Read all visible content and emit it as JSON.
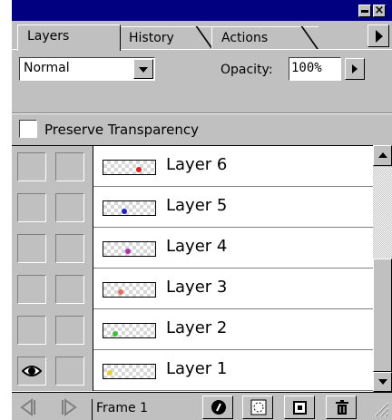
{
  "tabs": [
    {
      "label": "Layers",
      "active": true
    },
    {
      "label": "History",
      "active": false
    },
    {
      "label": "Actions",
      "active": false
    }
  ],
  "blend": {
    "mode": "Normal",
    "opacity_label": "Opacity:",
    "opacity_value": "100%"
  },
  "preserve": {
    "label": "Preserve Transparency",
    "checked": false
  },
  "layers": [
    {
      "name": "Layer 6",
      "visible": false,
      "thumb_icon": "red-mark",
      "thumb_color": "#e02020"
    },
    {
      "name": "Layer 5",
      "visible": false,
      "thumb_icon": "blue-mark",
      "thumb_color": "#2020c0"
    },
    {
      "name": "Layer 4",
      "visible": false,
      "thumb_icon": "purple-mark",
      "thumb_color": "#b030b0"
    },
    {
      "name": "Layer 3",
      "visible": false,
      "thumb_icon": "orange-mark",
      "thumb_color": "#e07060"
    },
    {
      "name": "Layer 2",
      "visible": false,
      "thumb_icon": "green-mark",
      "thumb_color": "#40c040"
    },
    {
      "name": "Layer 1",
      "visible": true,
      "thumb_icon": "yellow-mark",
      "thumb_color": "#e8d040"
    }
  ],
  "footer": {
    "frame_label": "Frame 1"
  },
  "colors": {
    "panel_bg": "#c0c0c0",
    "titlebar": "#000080",
    "list_bg": "#ffffff"
  }
}
